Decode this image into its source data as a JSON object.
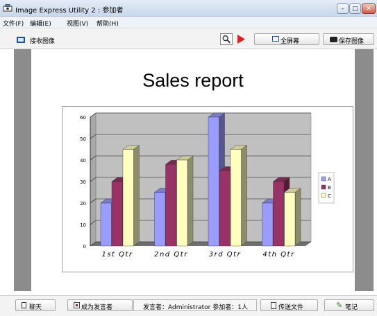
{
  "window": {
    "title": "Image Express Utility 2 : 参加者",
    "controls": {
      "minimize": "–",
      "maximize": "□",
      "close": "✕"
    }
  },
  "menu": {
    "items": [
      "文件(F)",
      "编辑(E)",
      "视图(V)",
      "帮助(H)"
    ]
  },
  "toolbar": {
    "receive_label": "接收图像",
    "fullscreen_label": "全屏幕",
    "save_label": "保存图像"
  },
  "slide": {
    "title": "Sales report"
  },
  "colors": {
    "series_a": "#9a9cff",
    "series_b": "#993366",
    "series_c": "#ffffc0",
    "plot_wall": "#c0c0c0",
    "viewer_background": "#8c8c8c"
  },
  "chart_data": {
    "type": "bar",
    "categories": [
      "1st Qtr",
      "2nd Qtr",
      "3rd Qtr",
      "4th Qtr"
    ],
    "series": [
      {
        "name": "A",
        "values": [
          20,
          25,
          60,
          20
        ]
      },
      {
        "name": "B",
        "values": [
          30,
          38,
          35,
          30
        ]
      },
      {
        "name": "C",
        "values": [
          45,
          40,
          45,
          25
        ]
      }
    ],
    "yticks": [
      "0",
      "10",
      "20",
      "30",
      "40",
      "50",
      "60"
    ],
    "ylim": [
      0,
      60
    ],
    "grid": true,
    "legend": "right",
    "style": "3d-clustered-column"
  },
  "status": {
    "chat_label": "聊天",
    "presenter_label": "成为发言者",
    "info": "发言者：Administrator   参加者：1人",
    "send_label": "传送文件",
    "notes_label": "笔记"
  }
}
